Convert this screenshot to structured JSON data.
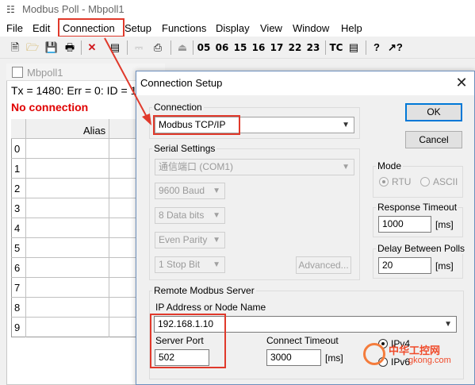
{
  "app": {
    "title": "Modbus Poll - Mbpoll1",
    "icon": "modbus-app-icon"
  },
  "menu": [
    "File",
    "Edit",
    "Connection",
    "Setup",
    "Functions",
    "Display",
    "View",
    "Window",
    "Help"
  ],
  "toolbar": {
    "function_codes": [
      "05",
      "06",
      "15",
      "16",
      "17",
      "22",
      "23"
    ],
    "tc_label": "TC",
    "icons": [
      "new-file-icon",
      "open-folder-icon",
      "save-icon",
      "print-icon",
      "disconnect-icon",
      "window-icon",
      "connect-icon",
      "printer-icon",
      "pulse-icon",
      "monitor-icon",
      "help-icon",
      "context-help-icon"
    ]
  },
  "child_window": {
    "title": "Mbpoll1",
    "status": "Tx = 1480: Err = 0: ID = 1",
    "connection_status": "No connection",
    "grid_header": "Alias",
    "rows": [
      "0",
      "1",
      "2",
      "3",
      "4",
      "5",
      "6",
      "7",
      "8",
      "9"
    ]
  },
  "dialog": {
    "title": "Connection Setup",
    "connection_group": "Connection",
    "connection_value": "Modbus TCP/IP",
    "ok_label": "OK",
    "cancel_label": "Cancel",
    "serial_group": "Serial Settings",
    "port": "通信端口 (COM1)",
    "baud": "9600 Baud",
    "data_bits": "8 Data bits",
    "parity": "Even Parity",
    "stop_bits": "1 Stop Bit",
    "advanced_label": "Advanced...",
    "mode_group": "Mode",
    "mode_rtu": "RTU",
    "mode_ascii": "ASCII",
    "mode_selected": "RTU",
    "response_group": "Response Timeout",
    "response_value": "1000",
    "delay_group": "Delay Between Polls",
    "delay_value": "20",
    "ms_unit": "[ms]",
    "remote_group": "Remote Modbus Server",
    "ip_label": "IP Address or Node Name",
    "ip_value": "192.168.1.10",
    "port_label": "Server Port",
    "port_value": "502",
    "timeout_label": "Connect Timeout",
    "timeout_value": "3000",
    "ipv4_label": "IPv4",
    "ipv6_label": "IPv6",
    "ip_version_selected": "IPv4"
  },
  "watermark": {
    "text": "中华工控网",
    "url": "gkong.com"
  },
  "colors": {
    "highlight": "#e0392b",
    "error_text": "#e00000",
    "accent": "#0078d7"
  }
}
